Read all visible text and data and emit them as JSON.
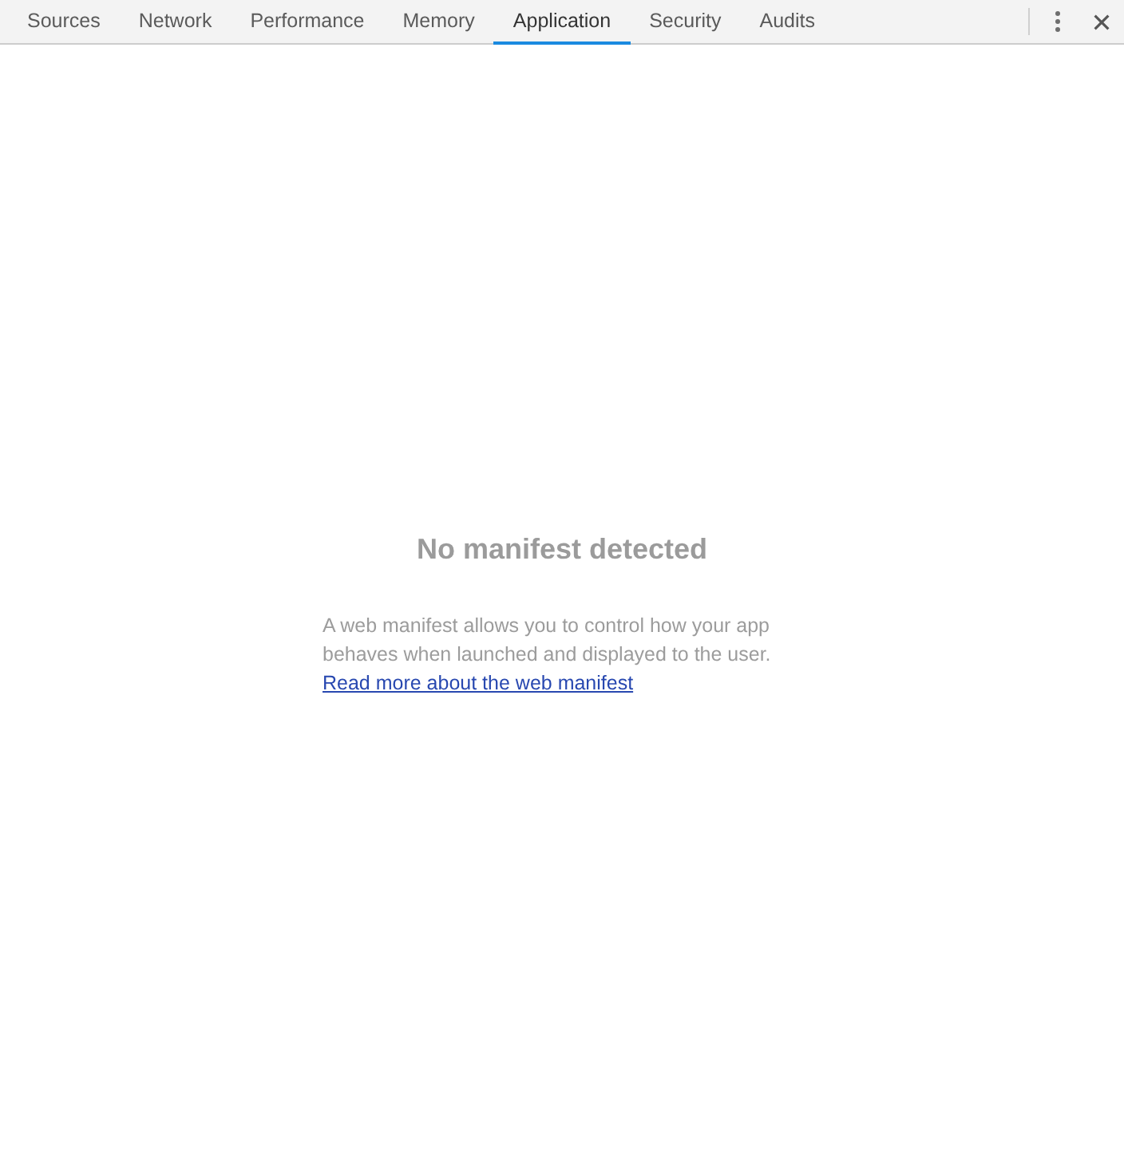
{
  "tabs": [
    {
      "label": "Sources",
      "selected": false
    },
    {
      "label": "Network",
      "selected": false
    },
    {
      "label": "Performance",
      "selected": false
    },
    {
      "label": "Memory",
      "selected": false
    },
    {
      "label": "Application",
      "selected": true
    },
    {
      "label": "Security",
      "selected": false
    },
    {
      "label": "Audits",
      "selected": false
    }
  ],
  "empty_state": {
    "title": "No manifest detected",
    "text": "A web manifest allows you to control how your app behaves when launched and displayed to the user.",
    "link": "Read more about the web manifest"
  }
}
